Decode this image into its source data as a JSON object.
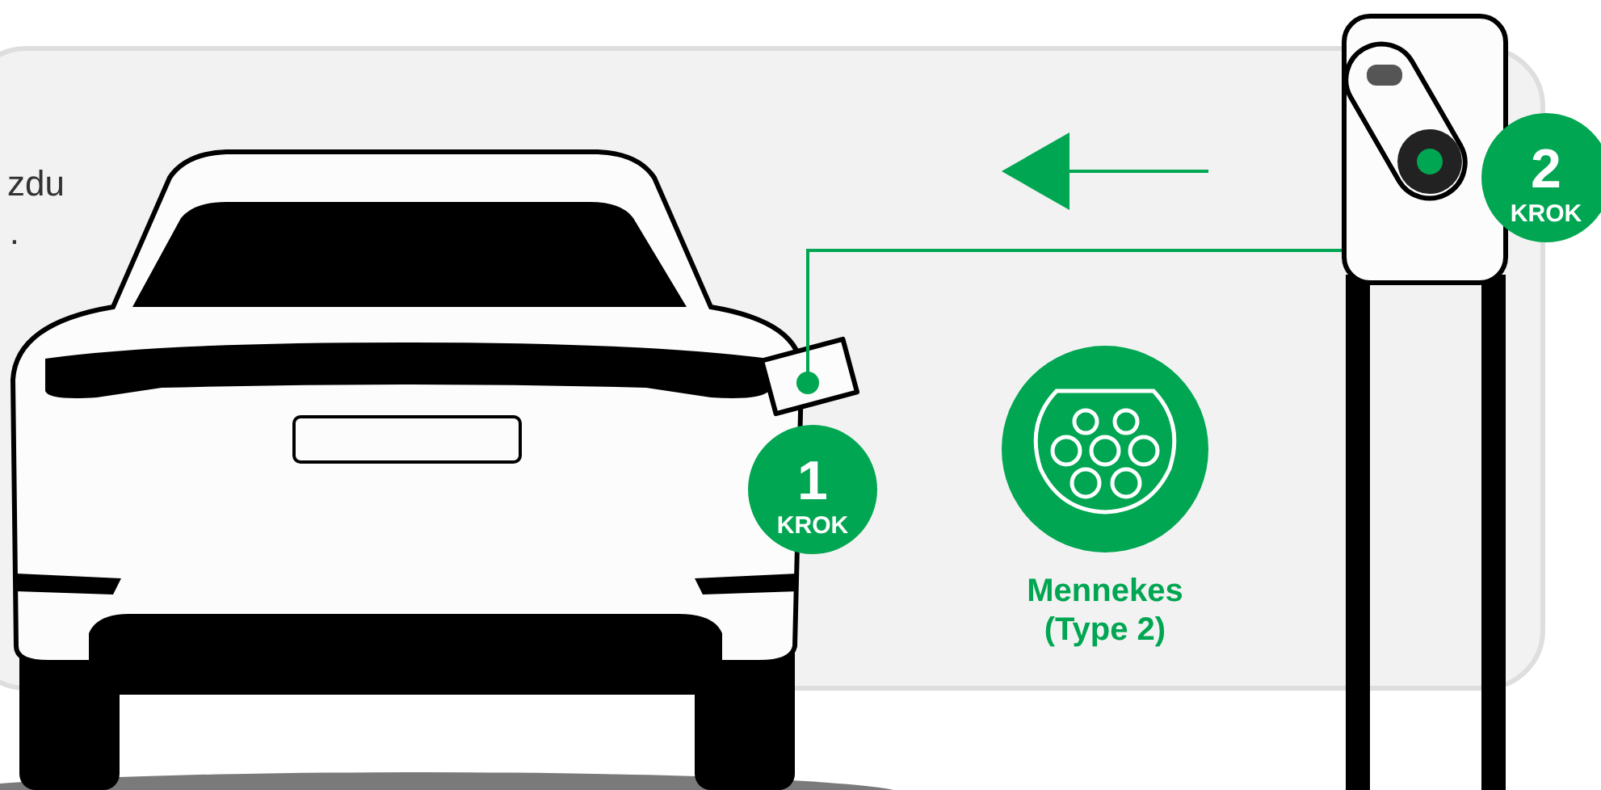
{
  "intro_text": [
    "zdu",
    "."
  ],
  "steps": [
    {
      "number": "1",
      "label": "KROK"
    },
    {
      "number": "2",
      "label": "KROK"
    }
  ],
  "connector": {
    "name": "Mennekes",
    "type": "(Type 2)"
  }
}
